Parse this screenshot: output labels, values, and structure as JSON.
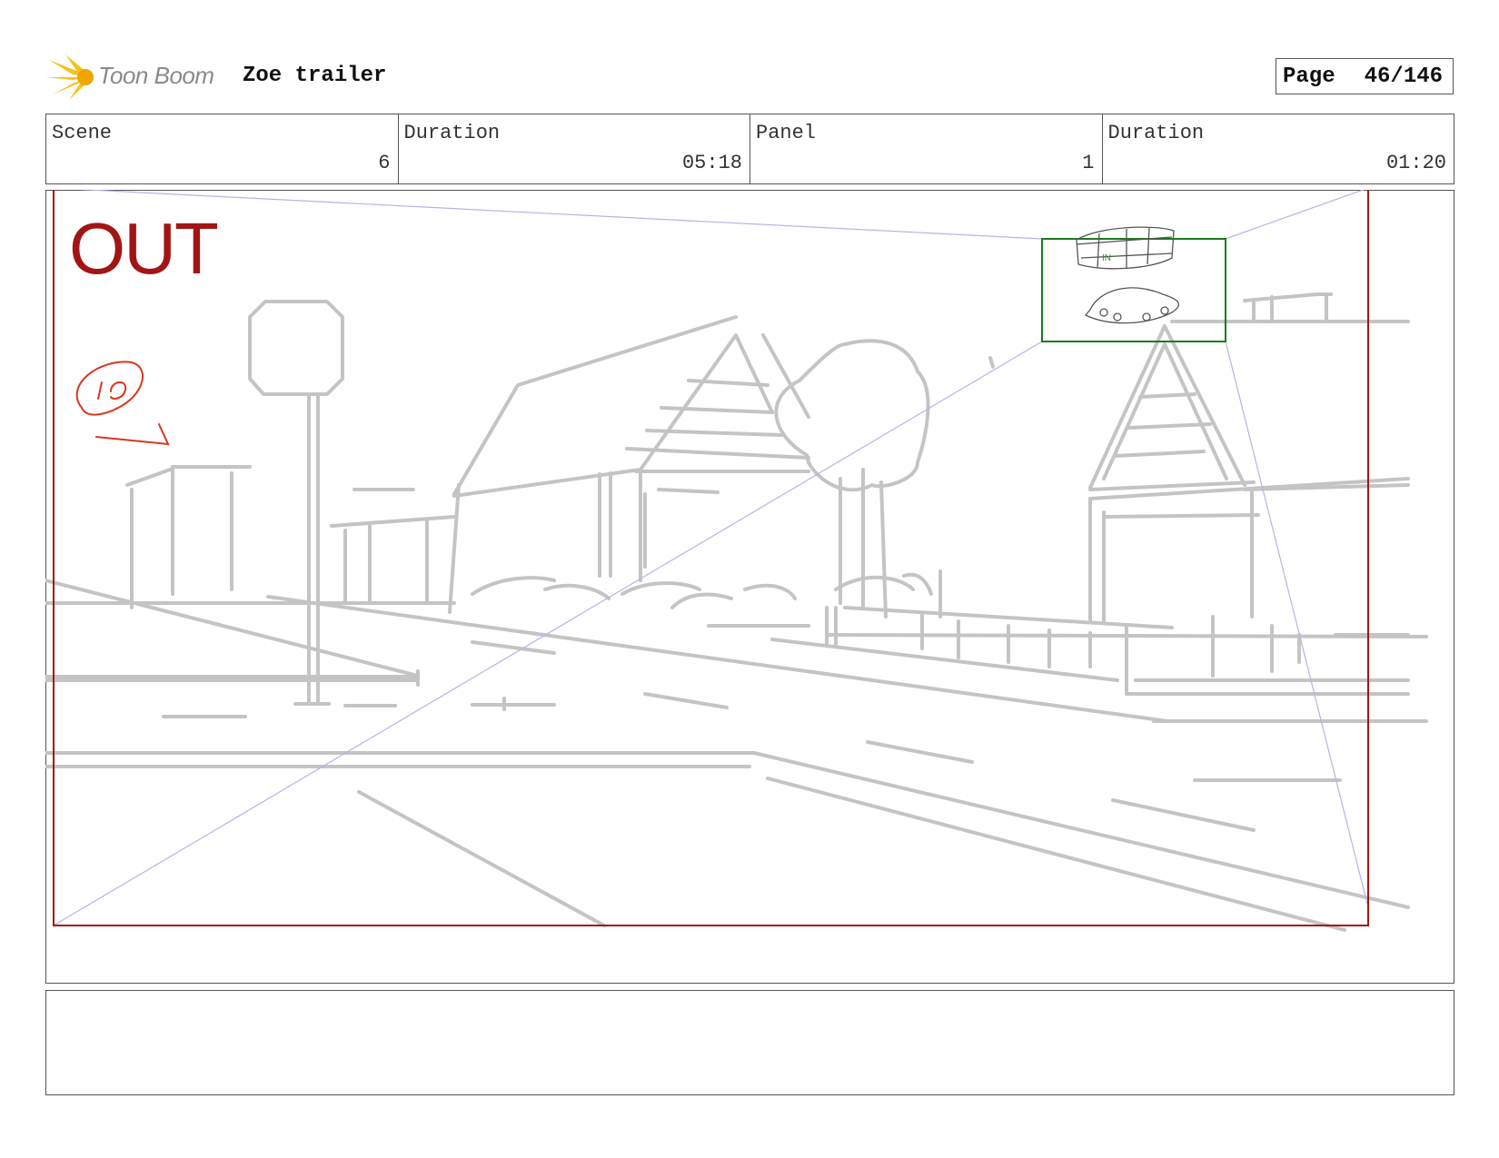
{
  "header": {
    "logo_text": "Toon Boom",
    "title": "Zoe trailer",
    "page_label": "Page",
    "page_value": "46/146"
  },
  "info": {
    "scene_label": "Scene",
    "scene_value": "6",
    "scene_duration_label": "Duration",
    "scene_duration_value": "05:18",
    "panel_label": "Panel",
    "panel_value": "1",
    "panel_duration_label": "Duration",
    "panel_duration_value": "01:20"
  },
  "panel": {
    "out_label": "OUT",
    "in_label": "IN",
    "annotation": "12"
  },
  "colors": {
    "out_frame": "#a31515",
    "in_frame": "#1c7a1c",
    "sketch": "#c4c4c4",
    "camera_lines": "#b4b4e6",
    "annotation": "#d9361f"
  },
  "notes": {
    "text": ""
  }
}
